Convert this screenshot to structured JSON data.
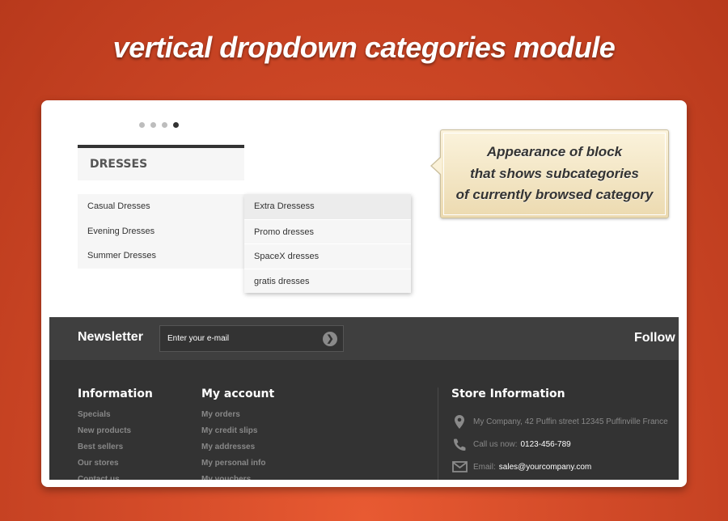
{
  "headline": "vertical dropdown categories module",
  "carousel": {
    "dot_count": 4,
    "active_index": 3
  },
  "categories_block": {
    "title": "DRESSES",
    "items": [
      "Casual Dresses",
      "Evening Dresses",
      "Summer Dresses"
    ],
    "subitems": [
      "Extra Dressess",
      "Promo dresses",
      "SpaceX dresses",
      "gratis dresses"
    ]
  },
  "callout": {
    "lines": [
      "Appearance of block",
      "that shows subcategories",
      "of currently browsed category"
    ]
  },
  "newsletter": {
    "title": "Newsletter",
    "placeholder": "Enter your e-mail",
    "follow": "Follow"
  },
  "footer": {
    "information": {
      "title": "Information",
      "links": [
        "Specials",
        "New products",
        "Best sellers",
        "Our stores",
        "Contact us"
      ]
    },
    "account": {
      "title": "My account",
      "links": [
        "My orders",
        "My credit slips",
        "My addresses",
        "My personal info",
        "My vouchers"
      ]
    },
    "store": {
      "title": "Store Information",
      "address": "My Company, 42 Puffin street 12345 Puffinville France",
      "call_label": "Call us now:",
      "phone": "0123-456-789",
      "email_label": "Email:",
      "email": "sales@yourcompany.com"
    }
  },
  "colors": {
    "background": "#d24a28",
    "card": "#ffffff",
    "footer_dark": "#333333",
    "newsletter_bar": "#3f3f3f",
    "callout": "#f5e6c2"
  }
}
